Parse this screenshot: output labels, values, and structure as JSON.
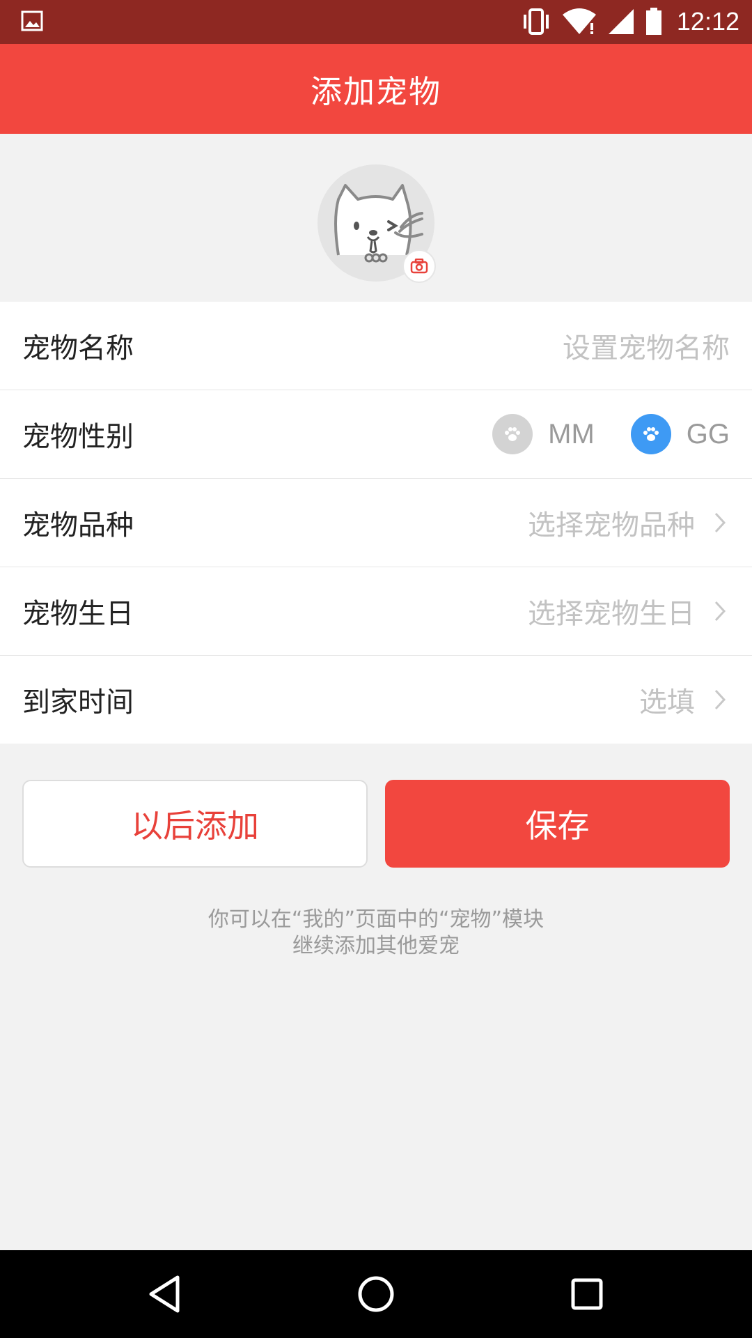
{
  "status_bar": {
    "time": "12:12",
    "icons": [
      "gallery-icon",
      "vibrate-icon",
      "wifi-icon",
      "signal-icon",
      "battery-icon"
    ]
  },
  "app_bar": {
    "title": "添加宠物"
  },
  "avatar": {
    "icon": "cat-avatar-icon",
    "badge_icon": "camera-icon"
  },
  "form": {
    "name": {
      "label": "宠物名称",
      "placeholder": "设置宠物名称"
    },
    "gender": {
      "label": "宠物性别",
      "options": [
        {
          "label": "MM",
          "selected": false
        },
        {
          "label": "GG",
          "selected": true
        }
      ]
    },
    "breed": {
      "label": "宠物品种",
      "placeholder": "选择宠物品种"
    },
    "birthday": {
      "label": "宠物生日",
      "placeholder": "选择宠物生日"
    },
    "arrival": {
      "label": "到家时间",
      "placeholder": "选填"
    }
  },
  "buttons": {
    "later": "以后添加",
    "save": "保存"
  },
  "hint": {
    "line1": "你可以在“我的”页面中的“宠物”模块",
    "line2": "继续添加其他爱宠"
  },
  "colors": {
    "accent": "#f2473f",
    "status_bar": "#8e2822",
    "selected_gender": "#3e9af4"
  }
}
